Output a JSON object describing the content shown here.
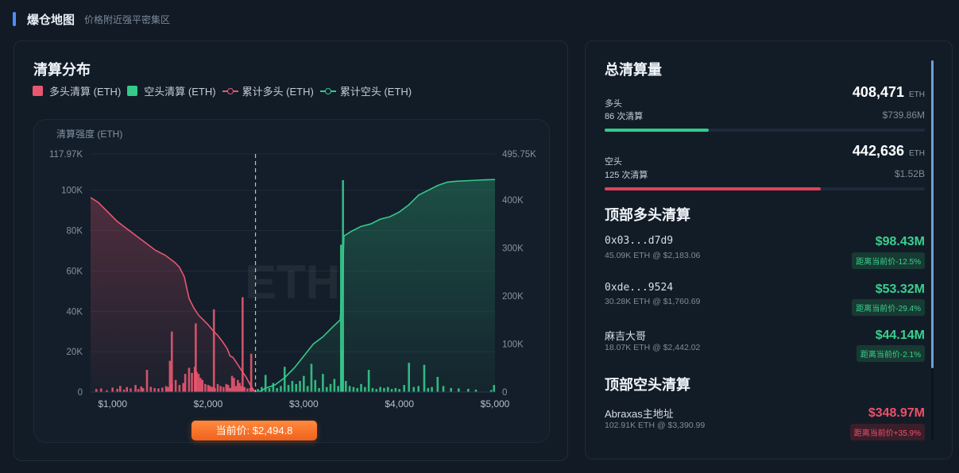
{
  "header": {
    "title": "爆仓地图",
    "subtitle": "价格附近强平密集区"
  },
  "chart_title": "清算分布",
  "legend": [
    {
      "label": "多头清算 (ETH)",
      "kind": "box",
      "color": "#e95670"
    },
    {
      "label": "空头清算 (ETH)",
      "kind": "box",
      "color": "#35c98a"
    },
    {
      "label": "累计多头 (ETH)",
      "kind": "line",
      "color": "#e95670"
    },
    {
      "label": "累计空头 (ETH)",
      "kind": "line",
      "color": "#35c98a"
    }
  ],
  "current_price_label": "当前价: $2,494.8",
  "chart_data": {
    "type": "bar",
    "ylabel": "清算强度 (ETH)",
    "watermark": "ETH",
    "x_ticks": [
      {
        "value": 1000,
        "label": "$1,000"
      },
      {
        "value": 2000,
        "label": "$2,000"
      },
      {
        "value": 3000,
        "label": "$3,000"
      },
      {
        "value": 4000,
        "label": "$4,000"
      },
      {
        "value": 5000,
        "label": "$5,000"
      }
    ],
    "xlim": [
      770,
      5000
    ],
    "ylim_left": [
      0,
      117970
    ],
    "left_ticks": [
      {
        "value": 117970,
        "label": "117.97K"
      },
      {
        "value": 100000,
        "label": "100K"
      },
      {
        "value": 80000,
        "label": "80K"
      },
      {
        "value": 60000,
        "label": "60K"
      },
      {
        "value": 40000,
        "label": "40K"
      },
      {
        "value": 20000,
        "label": "20K"
      },
      {
        "value": 0,
        "label": "0"
      }
    ],
    "ylim_right": [
      0,
      495750
    ],
    "right_ticks": [
      {
        "value": 495750,
        "label": "495.75K"
      },
      {
        "value": 400000,
        "label": "400K"
      },
      {
        "value": 300000,
        "label": "300K"
      },
      {
        "value": 200000,
        "label": "200K"
      },
      {
        "value": 100000,
        "label": "100K"
      },
      {
        "value": 0,
        "label": "0"
      }
    ],
    "current_price": 2494.8,
    "long_bars": [
      [
        830,
        1500
      ],
      [
        880,
        1800
      ],
      [
        940,
        900
      ],
      [
        1000,
        2200
      ],
      [
        1050,
        1600
      ],
      [
        1080,
        3000
      ],
      [
        1120,
        1200
      ],
      [
        1150,
        2500
      ],
      [
        1190,
        1800
      ],
      [
        1240,
        3500
      ],
      [
        1270,
        1500
      ],
      [
        1300,
        2800
      ],
      [
        1320,
        2000
      ],
      [
        1360,
        11000
      ],
      [
        1400,
        2600
      ],
      [
        1440,
        2000
      ],
      [
        1480,
        1800
      ],
      [
        1520,
        2200
      ],
      [
        1560,
        3000
      ],
      [
        1580,
        2500
      ],
      [
        1600,
        15500
      ],
      [
        1620,
        4000
      ],
      [
        1660,
        6000
      ],
      [
        1700,
        3500
      ],
      [
        1740,
        4500
      ],
      [
        1760,
        9000
      ],
      [
        1800,
        12000
      ],
      [
        1830,
        9500
      ],
      [
        1860,
        12500
      ],
      [
        1880,
        10000
      ],
      [
        1900,
        9000
      ],
      [
        1920,
        7000
      ],
      [
        1940,
        6000
      ],
      [
        1970,
        4000
      ],
      [
        2000,
        3500
      ],
      [
        2020,
        3000
      ],
      [
        2040,
        2500
      ],
      [
        2070,
        2000
      ],
      [
        2100,
        4000
      ],
      [
        2130,
        3000
      ],
      [
        2160,
        2500
      ],
      [
        2190,
        4000
      ],
      [
        2210,
        3500
      ],
      [
        2230,
        2000
      ],
      [
        2250,
        8000
      ],
      [
        2270,
        7000
      ],
      [
        2290,
        3000
      ],
      [
        2310,
        6000
      ],
      [
        2330,
        4500
      ],
      [
        2350,
        3000
      ],
      [
        2380,
        2500
      ],
      [
        2410,
        1800
      ],
      [
        2440,
        2000
      ],
      [
        2470,
        1500
      ]
    ],
    "long_spikes": [
      [
        1870,
        34000
      ],
      [
        2060,
        41000
      ],
      [
        2360,
        47000
      ],
      [
        1620,
        30000
      ],
      [
        2450,
        19000
      ]
    ],
    "short_bars": [
      [
        2520,
        1500
      ],
      [
        2560,
        2500
      ],
      [
        2600,
        8500
      ],
      [
        2640,
        2000
      ],
      [
        2680,
        4500
      ],
      [
        2720,
        2000
      ],
      [
        2760,
        3000
      ],
      [
        2800,
        12500
      ],
      [
        2840,
        3500
      ],
      [
        2880,
        5500
      ],
      [
        2920,
        4000
      ],
      [
        2960,
        5500
      ],
      [
        3000,
        8000
      ],
      [
        3040,
        3000
      ],
      [
        3080,
        14000
      ],
      [
        3120,
        6000
      ],
      [
        3160,
        2000
      ],
      [
        3200,
        9000
      ],
      [
        3240,
        2500
      ],
      [
        3280,
        4000
      ],
      [
        3320,
        6500
      ],
      [
        3360,
        3000
      ],
      [
        3400,
        21000
      ],
      [
        3440,
        5500
      ],
      [
        3480,
        3000
      ],
      [
        3520,
        2500
      ],
      [
        3560,
        2000
      ],
      [
        3600,
        4000
      ],
      [
        3640,
        2500
      ],
      [
        3680,
        11000
      ],
      [
        3720,
        2000
      ],
      [
        3760,
        1500
      ],
      [
        3800,
        2500
      ],
      [
        3840,
        2000
      ],
      [
        3880,
        2500
      ],
      [
        3920,
        1500
      ],
      [
        3960,
        2000
      ],
      [
        4000,
        1500
      ],
      [
        4050,
        3500
      ],
      [
        4100,
        14500
      ],
      [
        4150,
        2500
      ],
      [
        4200,
        3000
      ],
      [
        4260,
        13500
      ],
      [
        4300,
        2000
      ],
      [
        4340,
        2500
      ],
      [
        4400,
        7500
      ],
      [
        4460,
        3000
      ],
      [
        4540,
        2000
      ],
      [
        4620,
        1800
      ],
      [
        4720,
        1600
      ],
      [
        4800,
        1200
      ],
      [
        4960,
        1000
      ],
      [
        4990,
        3500
      ]
    ],
    "short_spikes": [
      [
        3410,
        105000
      ],
      [
        3390,
        73000
      ]
    ],
    "cumulative_long": [
      [
        770,
        405000
      ],
      [
        850,
        395000
      ],
      [
        950,
        375000
      ],
      [
        1050,
        355000
      ],
      [
        1150,
        340000
      ],
      [
        1250,
        325000
      ],
      [
        1350,
        310000
      ],
      [
        1450,
        295000
      ],
      [
        1550,
        285000
      ],
      [
        1650,
        270000
      ],
      [
        1700,
        260000
      ],
      [
        1750,
        240000
      ],
      [
        1800,
        195000
      ],
      [
        1850,
        175000
      ],
      [
        1900,
        160000
      ],
      [
        1950,
        150000
      ],
      [
        2000,
        140000
      ],
      [
        2050,
        128000
      ],
      [
        2100,
        118000
      ],
      [
        2150,
        105000
      ],
      [
        2200,
        90000
      ],
      [
        2230,
        75000
      ],
      [
        2260,
        72000
      ],
      [
        2300,
        60000
      ],
      [
        2350,
        45000
      ],
      [
        2400,
        30000
      ],
      [
        2440,
        15000
      ],
      [
        2480,
        3000
      ],
      [
        2494.8,
        0
      ]
    ],
    "cumulative_short": [
      [
        2494.8,
        0
      ],
      [
        2550,
        2000
      ],
      [
        2600,
        8000
      ],
      [
        2700,
        15000
      ],
      [
        2800,
        30000
      ],
      [
        2900,
        50000
      ],
      [
        3000,
        75000
      ],
      [
        3100,
        100000
      ],
      [
        3200,
        115000
      ],
      [
        3300,
        135000
      ],
      [
        3380,
        150000
      ],
      [
        3400,
        200000
      ],
      [
        3420,
        325000
      ],
      [
        3500,
        335000
      ],
      [
        3600,
        345000
      ],
      [
        3700,
        350000
      ],
      [
        3800,
        360000
      ],
      [
        3900,
        365000
      ],
      [
        4000,
        375000
      ],
      [
        4100,
        390000
      ],
      [
        4200,
        410000
      ],
      [
        4300,
        420000
      ],
      [
        4400,
        430000
      ],
      [
        4500,
        437000
      ],
      [
        4600,
        439000
      ],
      [
        4700,
        440000
      ],
      [
        4800,
        441000
      ],
      [
        4900,
        442000
      ],
      [
        5000,
        442636
      ]
    ]
  },
  "totals": {
    "title": "总清算量",
    "long": {
      "label": "多头",
      "count": "86 次清算",
      "amount": "408,471",
      "unit": "ETH",
      "usd": "$739.86M",
      "share": 0.324,
      "color": "#35c98a"
    },
    "short": {
      "label": "空头",
      "count": "125 次清算",
      "amount": "442,636",
      "unit": "ETH",
      "usd": "$1.52B",
      "share": 0.676,
      "color": "#e2405d"
    }
  },
  "top_long": {
    "title": "顶部多头清算",
    "items": [
      {
        "addr": "0x03...d7d9",
        "detail": "45.09K ETH @ $2,183.06",
        "usd": "$98.43M",
        "badge": "距离当前价-12.5%"
      },
      {
        "addr": "0xde...9524",
        "detail": "30.28K ETH @ $1,760.69",
        "usd": "$53.32M",
        "badge": "距离当前价-29.4%"
      },
      {
        "addr": "麻吉大哥",
        "detail": "18.07K ETH @ $2,442.02",
        "usd": "$44.14M",
        "badge": "距离当前价-2.1%"
      }
    ]
  },
  "top_short": {
    "title": "顶部空头清算",
    "items": [
      {
        "addr": "Abraxas主地址",
        "detail": "102.91K ETH @ $3,390.99",
        "usd": "$348.97M",
        "badge": "距离当前价+35.9%"
      }
    ]
  }
}
